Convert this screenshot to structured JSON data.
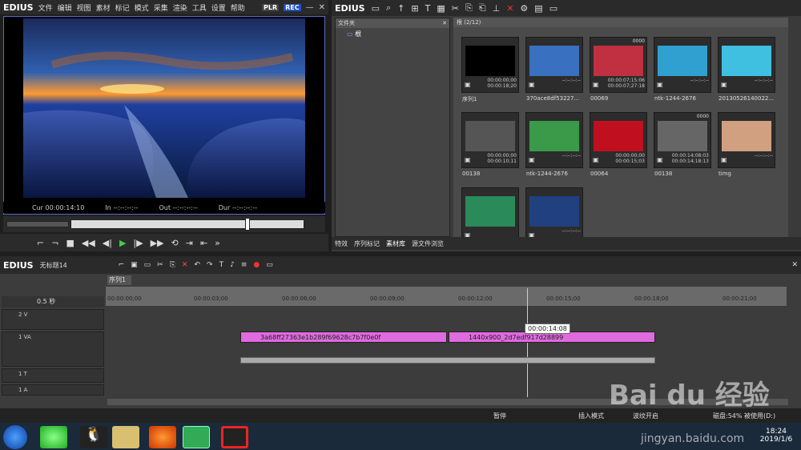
{
  "app": {
    "logo": "EDIUS",
    "plr": "PLR",
    "rec": "REC"
  },
  "menu": [
    "文件",
    "编辑",
    "视图",
    "素材",
    "标记",
    "模式",
    "采集",
    "渲染",
    "工具",
    "设置",
    "帮助"
  ],
  "player": {
    "cur_label": "Cur",
    "cur_value": "00:00:14:10",
    "in_label": "In",
    "in_value": "--:--:--:--",
    "out_label": "Out",
    "out_value": "--:--:--:--",
    "dur_label": "Dur",
    "dur_value": "--:--:--:--"
  },
  "bin": {
    "logo": "EDIUS",
    "folder_header": "文件夹",
    "root_label": "根",
    "path": "根 (2/12)",
    "clips": [
      {
        "name": "序列1",
        "tc1": "00:00:00;00",
        "tc2": "00:00:18;20",
        "badge": ""
      },
      {
        "name": "370ace8df53227...",
        "tc1": "--:--:--:--",
        "tc2": "",
        "badge": ""
      },
      {
        "name": "00069",
        "tc1": "00:00:07;15:06",
        "tc2": "00:00:07;27:18",
        "badge": "0000"
      },
      {
        "name": "ntk-1244-2676",
        "tc1": "--:--:--:--",
        "tc2": "",
        "badge": ""
      },
      {
        "name": "20130526140022...",
        "tc1": "--:--:--:--",
        "tc2": "",
        "badge": ""
      },
      {
        "name": "00138",
        "tc1": "00:00:00;00",
        "tc2": "00:00:10;11",
        "badge": ""
      },
      {
        "name": "ntk-1244-2676",
        "tc1": "--:--:--:--",
        "tc2": "",
        "badge": ""
      },
      {
        "name": "00064",
        "tc1": "00:00:00;00",
        "tc2": "00:00:15;03",
        "badge": ""
      },
      {
        "name": "00138",
        "tc1": "00:00:14;08:03",
        "tc2": "00:00:14;18:13",
        "badge": "0000"
      },
      {
        "name": "timg",
        "tc1": "--:--:--:--",
        "tc2": "",
        "badge": ""
      },
      {
        "name": "",
        "tc1": "",
        "tc2": "",
        "badge": ""
      },
      {
        "name": "",
        "tc1": "--:--:--:--",
        "tc2": "",
        "badge": ""
      }
    ],
    "tabs": [
      "特效",
      "序列标记",
      "素材库",
      "源文件浏览"
    ]
  },
  "timeline": {
    "logo": "EDIUS",
    "project": "无标题14",
    "seq_tab": "序列1",
    "zoom": "0.5 秒",
    "ruler": [
      "00:00:00;00",
      "00:00:03;00",
      "00:00:06;00",
      "00:00:09;00",
      "00:00:12;00",
      "00:00:15;00",
      "00:00:18;00",
      "00:00:21;00"
    ],
    "tracks": [
      "2 V",
      "1 VA",
      "1 T",
      "1 A"
    ],
    "clip1": "3a68ff27363e1b289f69628c7b7f0e0f",
    "clip2": "1440x900_2d7edf917d28899",
    "tooltip": "00:00:14:08"
  },
  "status": {
    "pause": "暂停",
    "insert": "插入模式",
    "wave": "波纹开启",
    "disk": "磁盘:54% 被使用(D:)"
  },
  "taskbar": {
    "time": "18:24",
    "date": "2019/1/6"
  },
  "watermark": {
    "brand": "Bai du 经验",
    "url": "jingyan.baidu.com"
  }
}
